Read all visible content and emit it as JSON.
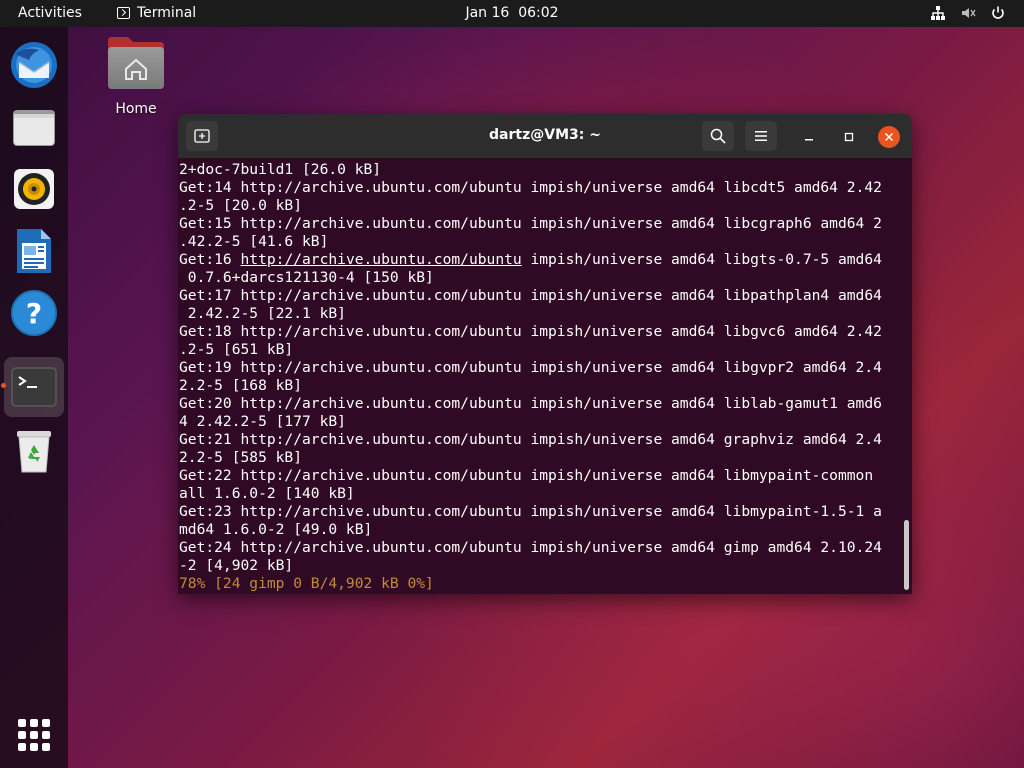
{
  "topbar": {
    "activities": "Activities",
    "app_name": "Terminal",
    "clock": "Jan 16  06:02"
  },
  "desktop": {
    "home_label": "Home"
  },
  "dock": {
    "items": [
      "thunderbird-mail",
      "files",
      "rhythmbox",
      "libreoffice-writer",
      "help",
      "terminal",
      "trash",
      "show-applications"
    ]
  },
  "terminal": {
    "title": "dartz@VM3: ~",
    "lines": [
      "2+doc-7build1 [26.0 kB]",
      "Get:14 http://archive.ubuntu.com/ubuntu impish/universe amd64 libcdt5 amd64 2.42",
      ".2-5 [20.0 kB]",
      "Get:15 http://archive.ubuntu.com/ubuntu impish/universe amd64 libcgraph6 amd64 2",
      ".42.2-5 [41.6 kB]",
      "Get:16 ",
      " 0.7.6+darcs121130-4 [150 kB]",
      "Get:17 http://archive.ubuntu.com/ubuntu impish/universe amd64 libpathplan4 amd64",
      " 2.42.2-5 [22.1 kB]",
      "Get:18 http://archive.ubuntu.com/ubuntu impish/universe amd64 libgvc6 amd64 2.42",
      ".2-5 [651 kB]",
      "Get:19 http://archive.ubuntu.com/ubuntu impish/universe amd64 libgvpr2 amd64 2.4",
      "2.2-5 [168 kB]",
      "Get:20 http://archive.ubuntu.com/ubuntu impish/universe amd64 liblab-gamut1 amd6",
      "4 2.42.2-5 [177 kB]",
      "Get:21 http://archive.ubuntu.com/ubuntu impish/universe amd64 graphviz amd64 2.4",
      "2.2-5 [585 kB]",
      "Get:22 http://archive.ubuntu.com/ubuntu impish/universe amd64 libmypaint-common",
      "all 1.6.0-2 [140 kB]",
      "Get:23 http://archive.ubuntu.com/ubuntu impish/universe amd64 libmypaint-1.5-1 a",
      "md64 1.6.0-2 [49.0 kB]",
      "Get:24 http://archive.ubuntu.com/ubuntu impish/universe amd64 gimp amd64 2.10.24",
      "-2 [4,902 kB]"
    ],
    "line16_link": "http://archive.ubuntu.com/ubuntu",
    "line16_rest": " impish/universe amd64 libgts-0.7-5 amd64",
    "progress": "78% [24 gimp 0 B/4,902 kB 0%]"
  },
  "colors": {
    "accent": "#e95420",
    "terminal_bg": "#300a24",
    "progress_text": "#c28a3a"
  }
}
